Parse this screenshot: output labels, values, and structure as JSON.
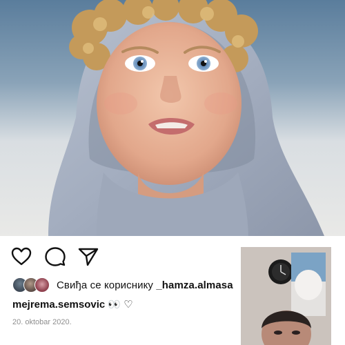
{
  "post": {
    "image_alt_icon": "photo-child-in-hoodie"
  },
  "actions": {
    "like_icon": "heart-icon",
    "comment_icon": "speech-bubble-icon",
    "share_icon": "paper-plane-icon"
  },
  "likes": {
    "prefix": "Свиђа се кориснику ",
    "username": "_hamza.almasa"
  },
  "caption": {
    "author": "mejrema.semsovic",
    "text": " 👀 ♡"
  },
  "date": "20. oktobar 2020.",
  "video_call": {
    "icon": "video-call-preview"
  },
  "colors": {
    "background": "#ffffff",
    "text": "#111111",
    "secondary_text": "#8e8e8e"
  }
}
